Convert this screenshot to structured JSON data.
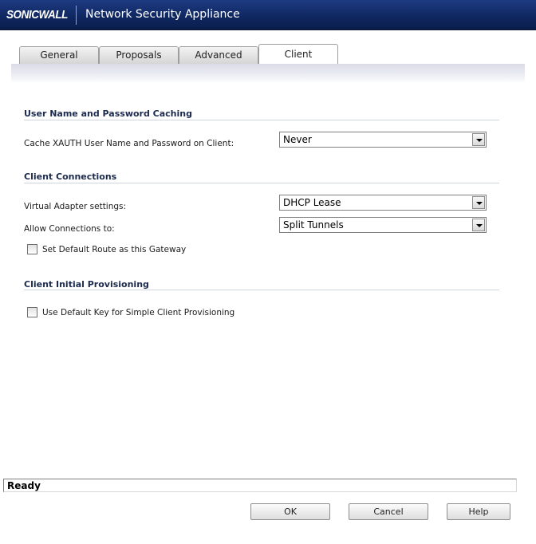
{
  "header": {
    "logo_text": "SONICWALL",
    "title": "Network Security Appliance"
  },
  "tabs": [
    {
      "label": "General",
      "active": false
    },
    {
      "label": "Proposals",
      "active": false
    },
    {
      "label": "Advanced",
      "active": false
    },
    {
      "label": "Client",
      "active": true
    }
  ],
  "sections": {
    "caching": {
      "title": "User Name and Password Caching",
      "cache_label": "Cache XAUTH User Name and Password on Client:",
      "cache_value": "Never"
    },
    "connections": {
      "title": "Client Connections",
      "adapter_label": "Virtual Adapter settings:",
      "adapter_value": "DHCP Lease",
      "allow_label": "Allow Connections to:",
      "allow_value": "Split Tunnels",
      "default_route_label": "Set Default Route as this Gateway",
      "default_route_checked": false
    },
    "provisioning": {
      "title": "Client Initial Provisioning",
      "default_key_label": "Use Default Key for Simple Client Provisioning",
      "default_key_checked": false
    }
  },
  "status": {
    "text": "Ready"
  },
  "buttons": {
    "ok": "OK",
    "cancel": "Cancel",
    "help": "Help"
  },
  "colors": {
    "header_bg": "#0f2760",
    "section_title": "#1c2a4e"
  }
}
